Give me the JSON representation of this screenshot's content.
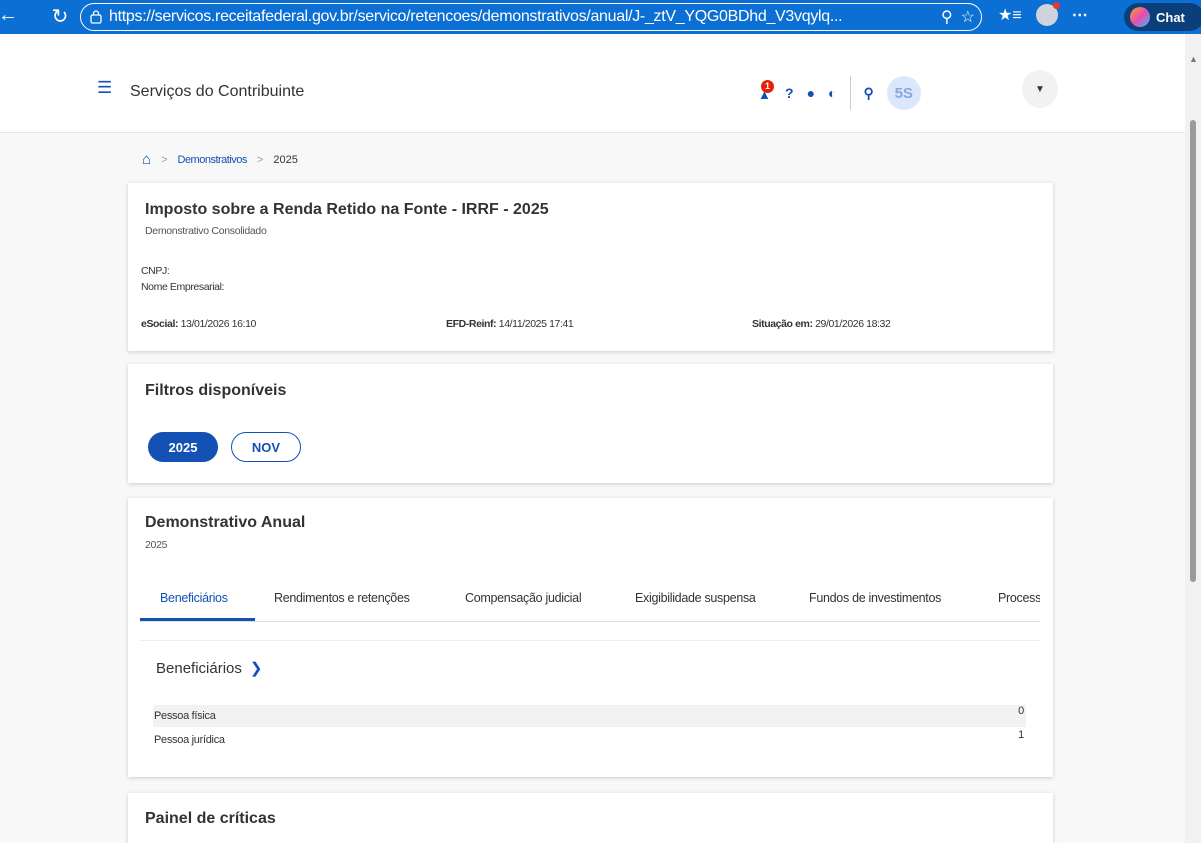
{
  "browser": {
    "back_icon": "arrow-left-icon",
    "reload_icon": "reload-icon",
    "url": "https://servicos.receitafederal.gov.br/servico/retencoes/demonstrativos/anual/J-_ztV_YQG0BDhd_V3vqylq...",
    "chat_label": "Chat"
  },
  "header": {
    "title": "Serviços do Contribuinte",
    "notification_count": "1",
    "avatar_initials": "5S"
  },
  "breadcrumb": {
    "items": [
      "Demonstrativos",
      "2025"
    ]
  },
  "summary": {
    "title": "Imposto sobre a Renda Retido na Fonte - IRRF - 2025",
    "subtitle": "Demonstrativo Consolidado",
    "cnpj_label": "CNPJ:",
    "nome_label": "Nome Empresarial:",
    "esocial_label": "eSocial:",
    "esocial_value": "13/01/2026 16:10",
    "efd_label": "EFD-Reinf:",
    "efd_value": "14/11/2025 17:41",
    "situacao_label": "Situação em:",
    "situacao_value": "29/01/2026 18:32"
  },
  "filters": {
    "title": "Filtros disponíveis",
    "chips": [
      "2025",
      "NOV"
    ]
  },
  "annual": {
    "title": "Demonstrativo Anual",
    "year": "2025",
    "tabs": [
      {
        "label": "Beneficiários"
      },
      {
        "label": "Rendimentos e retenções"
      },
      {
        "label": "Compensação judicial"
      },
      {
        "label": "Exigibilidade suspensa"
      },
      {
        "label": "Fundos de investimentos"
      },
      {
        "label": "Processos"
      }
    ],
    "section_title": "Beneficiários",
    "rows": [
      {
        "label": "Pessoa física",
        "value": "0"
      },
      {
        "label": "Pessoa jurídica",
        "value": "1"
      }
    ]
  },
  "criticas": {
    "title": "Painel de críticas"
  },
  "colors": {
    "primary": "#1351b4",
    "browser_bar": "#0b6fd4",
    "badge": "#e52207"
  }
}
